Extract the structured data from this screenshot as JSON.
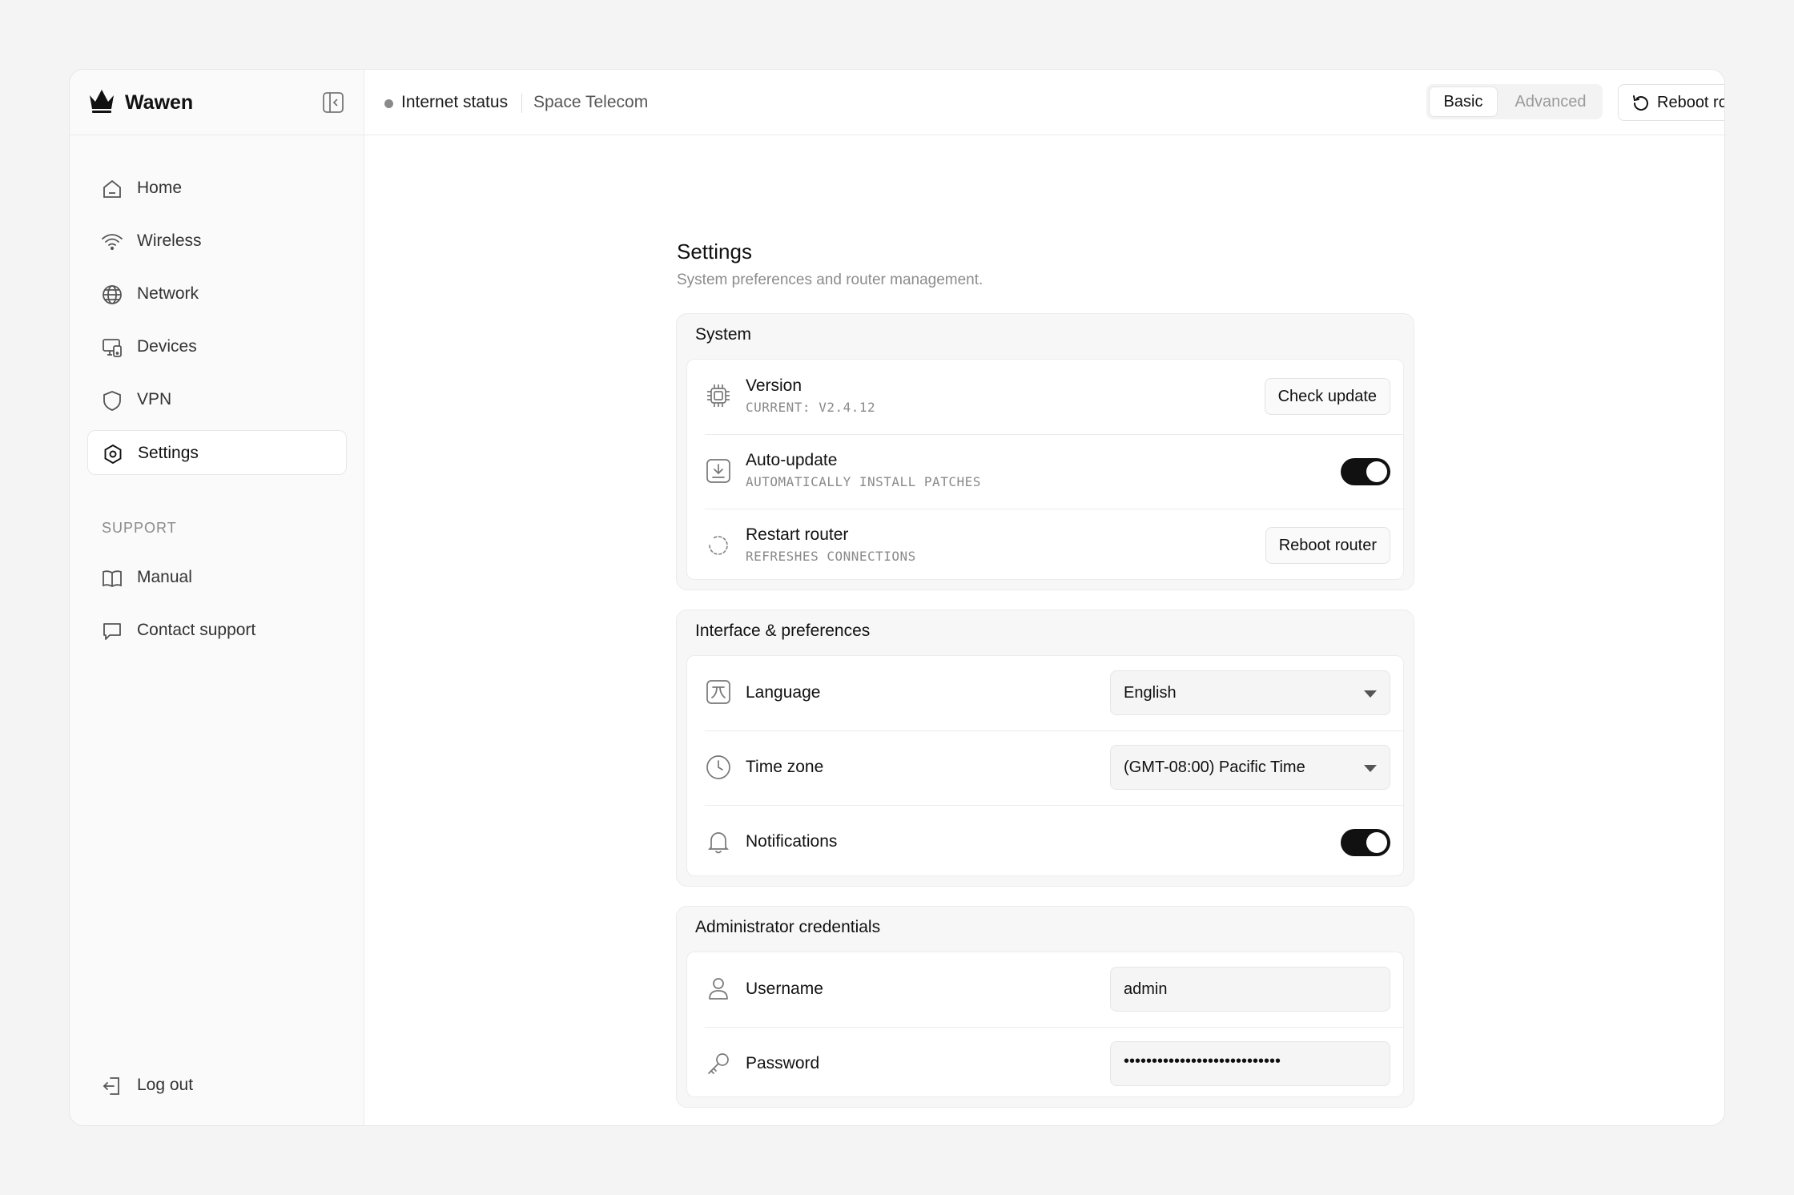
{
  "brand": {
    "name": "Wawen"
  },
  "sidebar": {
    "items": [
      {
        "label": "Home",
        "icon": "home-icon"
      },
      {
        "label": "Wireless",
        "icon": "wifi-icon"
      },
      {
        "label": "Network",
        "icon": "globe-icon"
      },
      {
        "label": "Devices",
        "icon": "devices-icon"
      },
      {
        "label": "VPN",
        "icon": "shield-icon"
      },
      {
        "label": "Settings",
        "icon": "gear-icon",
        "active": true
      }
    ],
    "support_label": "SUPPORT",
    "support_items": [
      {
        "label": "Manual",
        "icon": "book-icon"
      },
      {
        "label": "Contact support",
        "icon": "chat-icon"
      }
    ],
    "logout_label": "Log out"
  },
  "topbar": {
    "status_label": "Internet status",
    "isp": "Space Telecom",
    "mode_basic": "Basic",
    "mode_advanced": "Advanced",
    "reboot_label": "Reboot router"
  },
  "page": {
    "title": "Settings",
    "subtitle": "System preferences and router management."
  },
  "system": {
    "title": "System",
    "version_title": "Version",
    "version_sub": "CURRENT: V2.4.12",
    "check_update": "Check update",
    "autoupdate_title": "Auto-update",
    "autoupdate_sub": "AUTOMATICALLY INSTALL PATCHES",
    "autoupdate_on": true,
    "restart_title": "Restart router",
    "restart_sub": "REFRESHES CONNECTIONS",
    "reboot_button": "Reboot router"
  },
  "interface": {
    "title": "Interface & preferences",
    "language_label": "Language",
    "language_value": "English",
    "timezone_label": "Time zone",
    "timezone_value": "(GMT-08:00) Pacific Time",
    "notifications_label": "Notifications",
    "notifications_on": true
  },
  "credentials": {
    "title": "Administrator credentials",
    "username_label": "Username",
    "username_value": "admin",
    "password_label": "Password",
    "password_value": "••••••••••••••••••••••••••••"
  },
  "colors": {
    "accent": "#111111",
    "background": "#f4f4f4",
    "muted": "#8a8a8a"
  }
}
